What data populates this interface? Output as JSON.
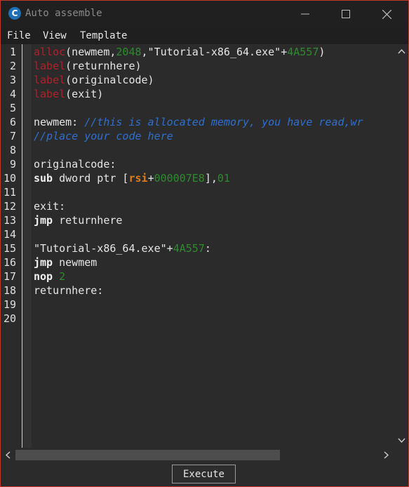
{
  "window": {
    "title": "Auto assemble",
    "icon": "cheat-engine-icon",
    "icon_glyph": "C",
    "accent_border": "#c0392b"
  },
  "menu": [
    "File",
    "View",
    "Template"
  ],
  "colors": {
    "keyword": "#b0202a",
    "number": "#2e8b2e",
    "comment": "#2f6fd0",
    "register": "#e07b18",
    "text": "#e6e6e6",
    "background": "#2b2b2b"
  },
  "line_numbers": [
    "1",
    "2",
    "3",
    "4",
    "5",
    "6",
    "7",
    "8",
    "9",
    "10",
    "11",
    "12",
    "13",
    "14",
    "15",
    "16",
    "17",
    "18",
    "19",
    "20"
  ],
  "code": {
    "l1": [
      "alloc",
      "(newmem,",
      "2048",
      ",\"Tutorial-x86_64.exe\"+",
      "4A557",
      ")"
    ],
    "l2": [
      "label",
      "(returnhere)"
    ],
    "l3": [
      "label",
      "(originalcode)"
    ],
    "l4": [
      "label",
      "(exit)"
    ],
    "l6": [
      "newmem: ",
      "//this is allocated memory, you have read,wr"
    ],
    "l7": [
      "//place your code here"
    ],
    "l9": [
      "originalcode:"
    ],
    "l10": [
      "sub",
      " dword ptr [",
      "rsi",
      "+",
      "000007E8",
      "],",
      "01"
    ],
    "l12": [
      "exit:"
    ],
    "l13": [
      "jmp",
      " returnhere"
    ],
    "l15": [
      "\"Tutorial-x86_64.exe\"+",
      "4A557",
      ":"
    ],
    "l16": [
      "jmp",
      " newmem"
    ],
    "l17": [
      "nop",
      " ",
      "2"
    ],
    "l18": [
      "returnhere:"
    ]
  },
  "footer": {
    "execute_label": "Execute"
  }
}
